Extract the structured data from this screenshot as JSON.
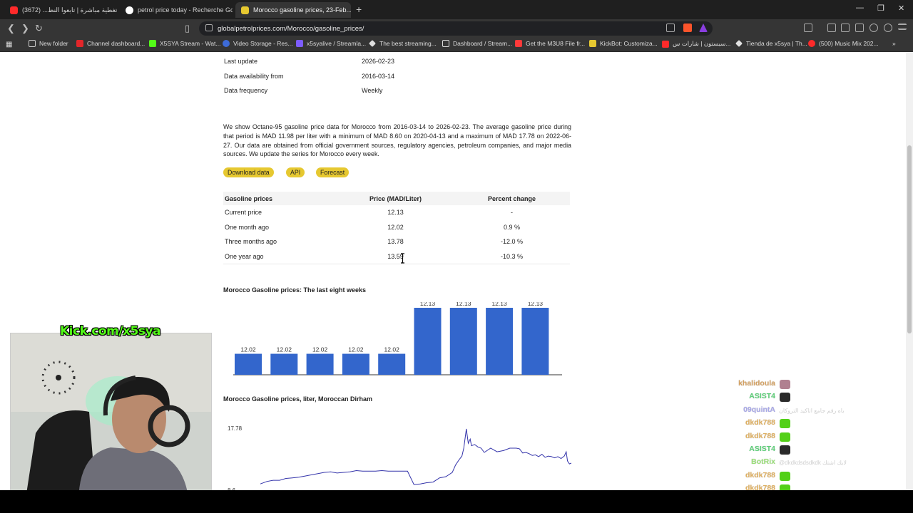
{
  "browser": {
    "tabs": [
      {
        "title": "تغطية مباشرة | تابعوا النظ...  (3672)",
        "icon_color": "#ff2a2a"
      },
      {
        "title": "petrol price today - Recherche Googl...",
        "icon_color": "#ffffff"
      },
      {
        "title": "Morocco gasoline prices, 23-Feb...",
        "icon_color": "#e6c830"
      }
    ],
    "url": "globalpetrolprices.com/Morocco/gasoline_prices/",
    "bookmarks": [
      {
        "label": "New folder",
        "color": "#c9c9c9"
      },
      {
        "label": "Channel dashboard...",
        "color": "#e3262a"
      },
      {
        "label": "X5SYA Stream - Wat...",
        "color": "#53fc18"
      },
      {
        "label": "Video Storage - Res...",
        "color": "#3d6bd8"
      },
      {
        "label": "x5syalive / Streamla...",
        "color": "#7c5cff"
      },
      {
        "label": "The best streaming...",
        "color": "#e0e0e0"
      },
      {
        "label": "Dashboard / Stream...",
        "color": "#e0e0e0"
      },
      {
        "label": "Get the M3U8 File fr...",
        "color": "#ff3a3a"
      },
      {
        "label": "KickBot: Customiza...",
        "color": "#e6c830"
      },
      {
        "label": "سيستون | شارات س...",
        "color": "#ff2a2a"
      },
      {
        "label": "Tienda de x5sya | Th...",
        "color": "#e0e0e0"
      },
      {
        "label": "(500) Music Mix 202...",
        "color": "#ff2a2a"
      }
    ]
  },
  "info": {
    "rows": [
      {
        "k": "Last update",
        "v": "2026-02-23"
      },
      {
        "k": "Data availability from",
        "v": "2016-03-14"
      },
      {
        "k": "Data frequency",
        "v": "Weekly"
      }
    ]
  },
  "description": "We show Octane-95 gasoline price data for Morocco from 2016-03-14 to 2026-02-23. The average gasoline price during that period is MAD 11.98 per liter with a minimum of MAD 8.60 on 2020-04-13 and a maximum of MAD 17.78 on 2022-06-27. Our data are obtained from official government sources, regulatory agencies, petroleum companies, and major media sources. We update the series for Morocco every week.",
  "buttons": {
    "download": "Download data",
    "api": "API",
    "forecast": "Forecast"
  },
  "price_table": {
    "headers": [
      "Gasoline prices",
      "Price (MAD/Liter)",
      "Percent change"
    ],
    "rows": [
      [
        "Current price",
        "12.13",
        "-"
      ],
      [
        "One month ago",
        "12.02",
        "0.9 %"
      ],
      [
        "Three months ago",
        "13.78",
        "-12.0 %"
      ],
      [
        "One year ago",
        "13.59",
        "-10.3 %"
      ]
    ]
  },
  "chart_data": [
    {
      "type": "bar",
      "title": "Morocco Gasoline prices: The last eight weeks",
      "categories": [
        "",
        "",
        "",
        "",
        "",
        "",
        "",
        "",
        ""
      ],
      "values": [
        12.02,
        12.02,
        12.02,
        12.02,
        12.02,
        12.13,
        12.13,
        12.13,
        12.13
      ],
      "color": "#3366cc",
      "xlabel": "",
      "ylabel": ""
    },
    {
      "type": "line",
      "title": "Morocco Gasoline prices, liter, Moroccan Dirham",
      "y_tick_labels": [
        "17.78",
        "8.6"
      ],
      "x": [
        0,
        10,
        20,
        30,
        40,
        50,
        60,
        70,
        80,
        90,
        100,
        110,
        120,
        130,
        140,
        150,
        160,
        170,
        180,
        190,
        200,
        210,
        220,
        230,
        240,
        250,
        260,
        270,
        280,
        290,
        300,
        305,
        310,
        315,
        318,
        322,
        325,
        328,
        330,
        335,
        340,
        345,
        350,
        360,
        370,
        380,
        390,
        400,
        405,
        410,
        415,
        420,
        425,
        430,
        435,
        440,
        445,
        450,
        455,
        460,
        465,
        470,
        475,
        478,
        480,
        483,
        486
      ],
      "values": [
        8.7,
        9.1,
        9.3,
        9.3,
        9.6,
        9.7,
        9.8,
        10.0,
        10.2,
        10.4,
        10.6,
        10.7,
        10.5,
        10.6,
        10.7,
        10.9,
        10.8,
        10.8,
        10.8,
        10.9,
        10.8,
        10.8,
        10.8,
        10.8,
        8.6,
        8.7,
        8.9,
        9.0,
        9.7,
        9.9,
        10.6,
        11.8,
        12.6,
        13.3,
        14.6,
        17.78,
        15.4,
        16.1,
        15.0,
        15.2,
        14.8,
        14.6,
        13.9,
        14.6,
        14.0,
        14.2,
        14.6,
        14.6,
        14.5,
        13.8,
        13.9,
        13.7,
        13.4,
        13.5,
        13.2,
        13.6,
        13.1,
        13.3,
        13.2,
        13.0,
        13.2,
        12.9,
        13.3,
        14.0,
        12.5,
        12.0,
        12.13
      ],
      "color": "#3333aa"
    }
  ],
  "overlay": {
    "kick": "Kick.com/x5sya",
    "chat": [
      {
        "user": "khalidoula",
        "color": "#d4a060",
        "msg": ""
      },
      {
        "user": "ASIST4",
        "color": "#5fd07a",
        "msg": ""
      },
      {
        "user": "09quintA",
        "color": "#a8a8e8",
        "msg": "باه رقم جامع اتاكيد التروكان"
      },
      {
        "user": "dkdk788",
        "color": "#e0b060",
        "msg": ""
      },
      {
        "user": "dkdk788",
        "color": "#e0b060",
        "msg": ""
      },
      {
        "user": "ASIST4",
        "color": "#5fd07a",
        "msg": ""
      },
      {
        "user": "BotRix",
        "color": "#9be07a",
        "msg": "@dkdkdsdsdkdk لايك اشتك"
      },
      {
        "user": "dkdk788",
        "color": "#e0b060",
        "msg": ""
      },
      {
        "user": "dkdk788",
        "color": "#e0b060",
        "msg": ""
      },
      {
        "user": "ASIST4",
        "color": "#5fd07a",
        "msg": ""
      }
    ]
  }
}
